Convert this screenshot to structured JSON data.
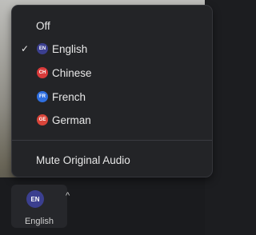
{
  "menu": {
    "items": [
      {
        "label": "Off",
        "checked": false
      },
      {
        "label": "English",
        "badge": "EN",
        "badge_color": "#3b3f8f",
        "checked": true
      },
      {
        "label": "Chinese",
        "badge": "CH",
        "badge_color": "#d93a3a",
        "checked": false
      },
      {
        "label": "French",
        "badge": "FR",
        "badge_color": "#2f6fe0",
        "checked": false
      },
      {
        "label": "German",
        "badge": "GE",
        "badge_color": "#d9453a",
        "checked": false
      }
    ],
    "check_glyph": "✓",
    "mute_label": "Mute Original Audio"
  },
  "tray": {
    "badge": "EN",
    "badge_color": "#3b3f8f",
    "caret": "^",
    "label": "English"
  }
}
